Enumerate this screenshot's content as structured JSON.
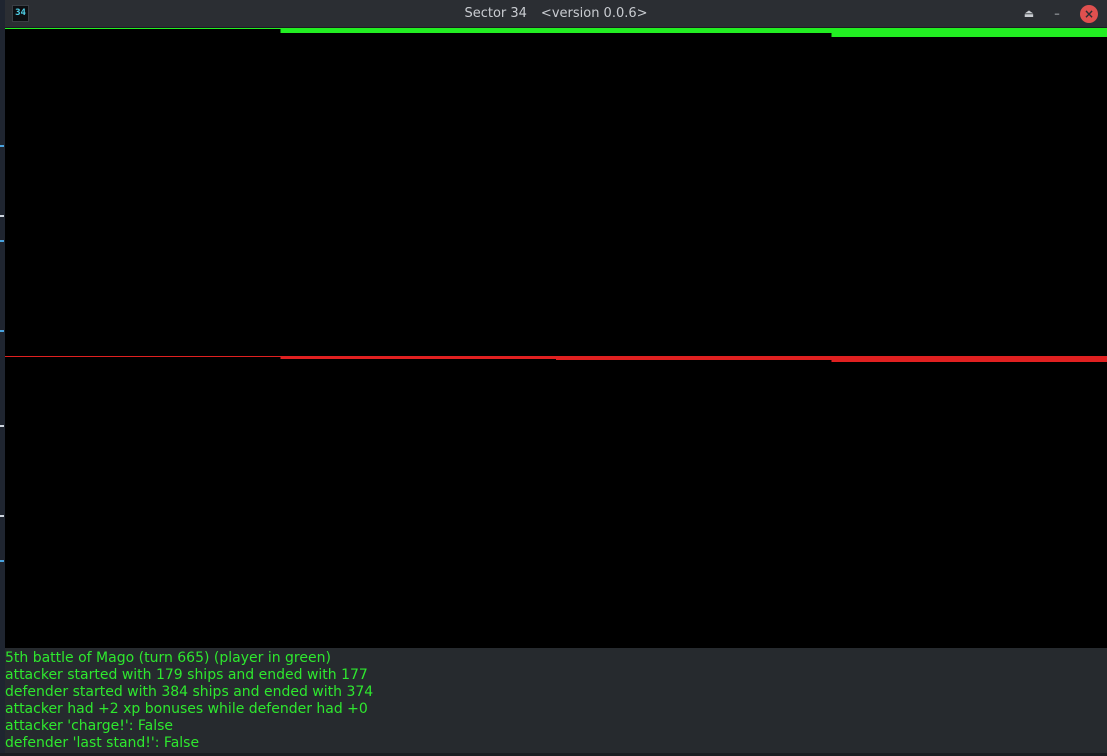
{
  "window": {
    "icon_label": "34",
    "title": "Sector 34",
    "version": "<version 0.0.6>",
    "buttons": {
      "maximize": "⏏",
      "minimize": "–",
      "close": "×"
    }
  },
  "colors": {
    "player": "#22ee22",
    "opponent": "#e02020",
    "log_text": "#2ee82e",
    "log_bg": "#262a2e",
    "chart_bg": "#000000"
  },
  "chart_data": {
    "type": "line",
    "steps": 4,
    "series": [
      {
        "color": "#22ee22",
        "values": [
          179,
          178,
          178,
          177
        ]
      },
      {
        "color": "#e02020",
        "values": [
          384,
          380,
          378,
          374
        ]
      }
    ]
  },
  "log": [
    "5th battle of Mago (turn 665) (player in green)",
    "attacker started with 179 ships and ended with 177",
    "defender started with 384 ships and ended with 374",
    "attacker had +2 xp bonuses while defender had +0",
    "attacker 'charge!': False",
    "defender 'last stand!': False"
  ]
}
